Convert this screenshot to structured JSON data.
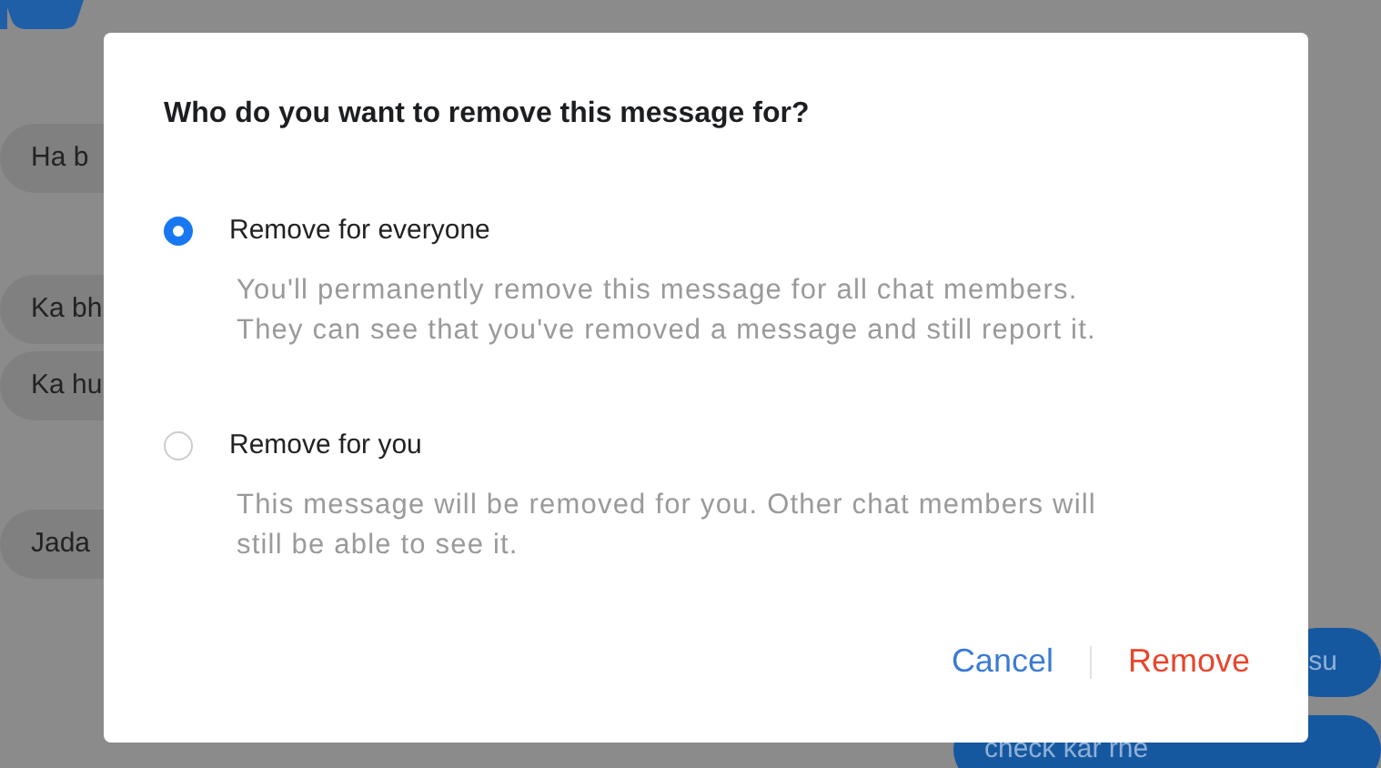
{
  "chat": {
    "received_messages": [
      {
        "text": "Ha b"
      },
      {
        "text": "Ka bh"
      },
      {
        "text": "Ka hu"
      },
      {
        "text": "Jada"
      }
    ],
    "sent_messages": [
      {
        "text": "su"
      },
      {
        "text": "check kar rhe"
      }
    ]
  },
  "dialog": {
    "title": "Who do you want to remove this message for?",
    "options": [
      {
        "label": "Remove for everyone",
        "description": "You'll permanently remove this message for all chat members. They can see that you've removed a message and still report it.",
        "selected": true
      },
      {
        "label": "Remove for you",
        "description": "This message will be removed for you. Other chat members will still be able to see it.",
        "selected": false
      }
    ],
    "buttons": [
      {
        "label": "Cancel",
        "kind": "cancel"
      },
      {
        "label": "Remove",
        "kind": "confirm"
      }
    ]
  }
}
